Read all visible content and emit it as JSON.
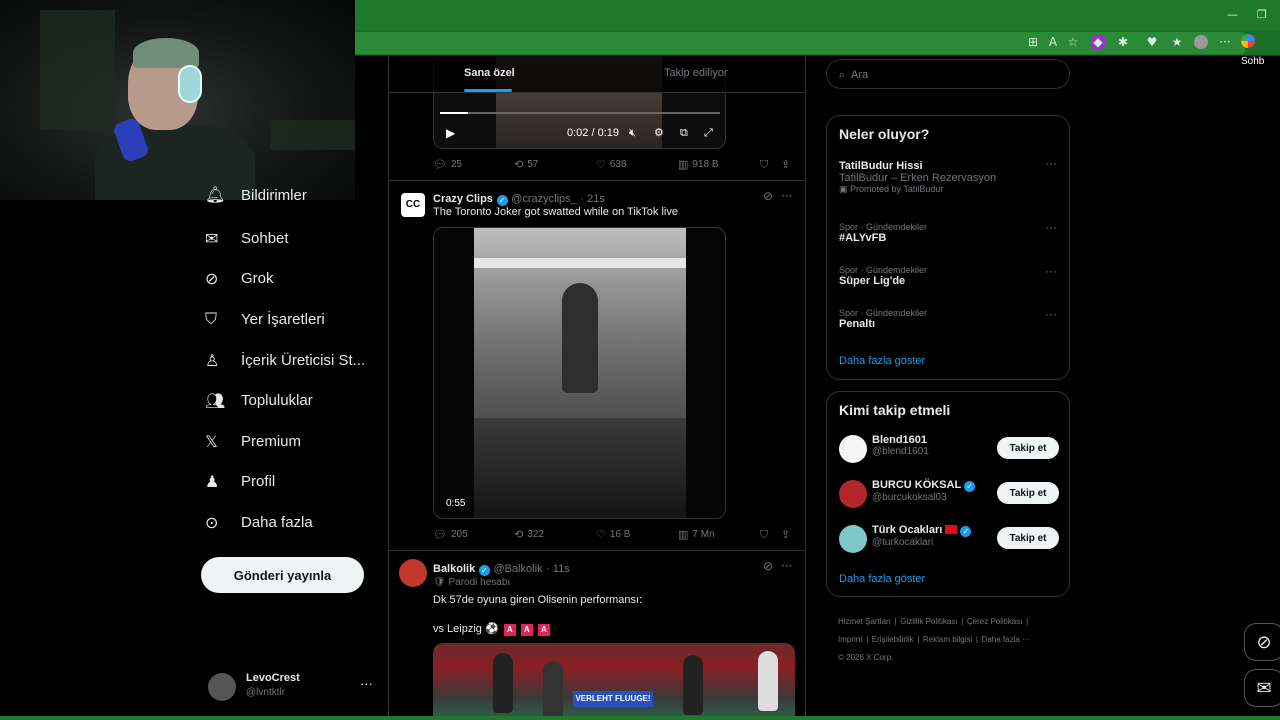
{
  "browser": {
    "window_buttons": [
      "—",
      "❐"
    ],
    "sohbet_label": "Sohb"
  },
  "sidebar": {
    "items": [
      {
        "label": "Bildirimler",
        "icon": "bell-icon"
      },
      {
        "label": "Sohbet",
        "icon": "envelope-icon"
      },
      {
        "label": "Grok",
        "icon": "grok-icon"
      },
      {
        "label": "Yer İşaretleri",
        "icon": "bookmark-icon"
      },
      {
        "label": "İçerik Üreticisi St...",
        "icon": "creator-studio-icon"
      },
      {
        "label": "Topluluklar",
        "icon": "communities-icon"
      },
      {
        "label": "Premium",
        "icon": "x-logo-icon"
      },
      {
        "label": "Profil",
        "icon": "profile-icon"
      },
      {
        "label": "Daha fazla",
        "icon": "more-circle-icon"
      }
    ],
    "post_button": "Gönderi yayınla",
    "account": {
      "name": "LevoCrest",
      "handle": "@lvntktlr",
      "more": "···"
    }
  },
  "main": {
    "tabs": [
      "Sana özel",
      "Takip ediliyor"
    ],
    "tweet1": {
      "video_time": "0:02 / 0:19",
      "progress": 0.1,
      "stats": {
        "replies": "25",
        "reposts": "57",
        "likes": "638",
        "views": "918 B"
      }
    },
    "tweet2": {
      "name": "Crazy Clips",
      "handle": "@crazyclips_",
      "time": "· 21s",
      "text": "The Toronto Joker got swatted while on TikTok live",
      "duration": "0:55",
      "stats": {
        "replies": "205",
        "reposts": "322",
        "likes": "16 B",
        "views": "7 Mn"
      }
    },
    "tweet3": {
      "name": "Balkolik",
      "handle": "@Balkolik",
      "time": "· 11s",
      "tag": "Parodi hesabı",
      "text": "Dk 57de oyuna giren Olisenin performansı:",
      "text2": "vs Leipzig",
      "badges": [
        "A",
        "A",
        "A"
      ],
      "banner": "VERLEHT FLUUGE!"
    }
  },
  "right": {
    "search_placeholder": "Ara",
    "trends_title": "Neler oluyor?",
    "trends": [
      {
        "name": "TatilBudur Hissi",
        "sub": "TatilBudur – Erken Rezervasyon",
        "promo": "Promoted by TatilBudur"
      },
      {
        "category": "Spor · Gündemdekiler",
        "name": "#ALYvFB"
      },
      {
        "category": "Spor · Gündemdekiler",
        "name": "Süper Lig'de"
      },
      {
        "category": "Spor · Gündemdekiler",
        "name": "Penaltı"
      }
    ],
    "show_more": "Daha fazla göster",
    "wtf_title": "Kimi takip etmeli",
    "who_to_follow": [
      {
        "name": "Blend1601",
        "handle": "@blend1601",
        "button": "Takip et"
      },
      {
        "name": "BURCU KÖKSAL",
        "handle": "@burcukoksal03",
        "button": "Takip et"
      },
      {
        "name": "Türk Ocakları",
        "handle": "@turkocaklari",
        "button": "Takip et"
      }
    ],
    "wtf_show_more": "Daha fazla göster",
    "footer": [
      "Hizmet Şartları",
      "Gizlilik Politikası",
      "Çerez Politikası",
      "Imprint",
      "Erişilebilirlik",
      "Reklam bilgisi",
      "Daha fazla ···",
      "© 2026 X Corp."
    ]
  }
}
